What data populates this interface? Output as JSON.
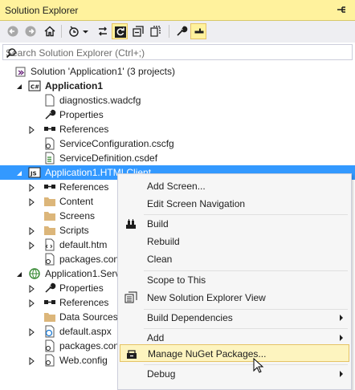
{
  "window": {
    "title": "Solution Explorer"
  },
  "toolbar": {
    "buttons": [
      "back-icon",
      "forward-icon",
      "home-icon",
      "history-icon",
      "dropdown-arrow-icon",
      "sync-icon",
      "refresh-icon",
      "collapse-all-icon",
      "show-all-files-icon",
      "properties-icon",
      "preview-icon"
    ]
  },
  "search": {
    "placeholder": "Search Solution Explorer (Ctrl+;)"
  },
  "tree": {
    "solution": "Solution 'Application1' (3 projects)",
    "app1": "Application1",
    "diagnostics": "diagnostics.wadcfg",
    "properties": "Properties",
    "references": "References",
    "service_config": "ServiceConfiguration.cscfg",
    "service_def": "ServiceDefinition.csdef",
    "html_client": "Application1.HTMLClient",
    "hc_references": "References",
    "content": "Content",
    "screens": "Screens",
    "scripts": "Scripts",
    "default_htm": "default.htm",
    "packages1": "packages.con",
    "server": "Application1.Serv",
    "sv_properties": "Properties",
    "sv_references": "References",
    "data_sources": "Data Sources",
    "default_aspx": "default.aspx",
    "packages2": "packages.con",
    "web_config": "Web.config"
  },
  "menu": {
    "add_screen": "Add Screen...",
    "edit_nav": "Edit Screen Navigation",
    "build": "Build",
    "rebuild": "Rebuild",
    "clean": "Clean",
    "scope": "Scope to This",
    "new_view": "New Solution Explorer View",
    "build_deps": "Build Dependencies",
    "add": "Add",
    "nuget": "Manage NuGet Packages...",
    "debug": "Debug"
  }
}
